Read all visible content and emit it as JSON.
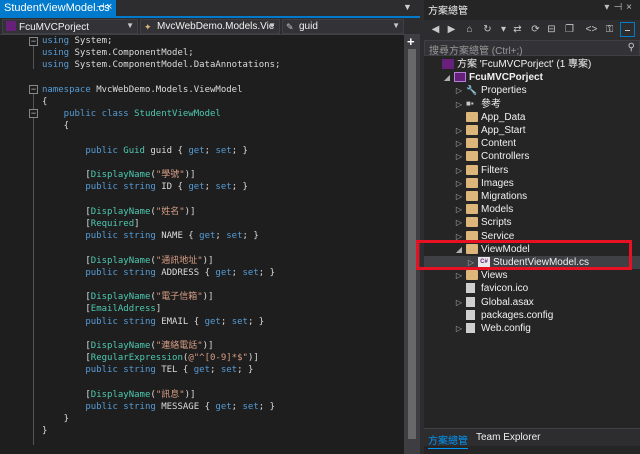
{
  "editor": {
    "tab_title": "StudentViewModel.cs",
    "tab_pin": "⊣",
    "tab_close": "×",
    "nav_project": "FcuMVCPorject",
    "nav_class": "MvcWebDemo.Models.Vie",
    "nav_member": "guid",
    "code_lines": [
      [
        {
          "t": "using",
          "c": "kw"
        },
        {
          "t": " System;",
          "c": "pl"
        }
      ],
      [
        {
          "t": "using",
          "c": "kw"
        },
        {
          "t": " System.ComponentModel;",
          "c": "pl"
        }
      ],
      [
        {
          "t": "using",
          "c": "kw"
        },
        {
          "t": " System.ComponentModel.DataAnnotations;",
          "c": "pl"
        }
      ],
      [],
      [
        {
          "t": "namespace",
          "c": "kw"
        },
        {
          "t": " MvcWebDemo.Models.ViewModel",
          "c": "pl"
        }
      ],
      [
        {
          "t": "{",
          "c": "pl"
        }
      ],
      [
        {
          "t": "    public class ",
          "c": "kw"
        },
        {
          "t": "StudentViewModel",
          "c": "ty"
        }
      ],
      [
        {
          "t": "    {",
          "c": "pl"
        }
      ],
      [],
      [
        {
          "t": "        public ",
          "c": "kw"
        },
        {
          "t": "Guid",
          "c": "ty"
        },
        {
          "t": " guid { ",
          "c": "pl"
        },
        {
          "t": "get",
          "c": "kw"
        },
        {
          "t": "; ",
          "c": "pl"
        },
        {
          "t": "set",
          "c": "kw"
        },
        {
          "t": "; }",
          "c": "pl"
        }
      ],
      [],
      [
        {
          "t": "        [",
          "c": "pl"
        },
        {
          "t": "DisplayName",
          "c": "ty"
        },
        {
          "t": "(",
          "c": "pl"
        },
        {
          "t": "\"學號\"",
          "c": "st"
        },
        {
          "t": ")]",
          "c": "pl"
        }
      ],
      [
        {
          "t": "        public string ",
          "c": "kw"
        },
        {
          "t": "ID { ",
          "c": "pl"
        },
        {
          "t": "get",
          "c": "kw"
        },
        {
          "t": "; ",
          "c": "pl"
        },
        {
          "t": "set",
          "c": "kw"
        },
        {
          "t": "; }",
          "c": "pl"
        }
      ],
      [],
      [
        {
          "t": "        [",
          "c": "pl"
        },
        {
          "t": "DisplayName",
          "c": "ty"
        },
        {
          "t": "(",
          "c": "pl"
        },
        {
          "t": "\"姓名\"",
          "c": "st"
        },
        {
          "t": ")]",
          "c": "pl"
        }
      ],
      [
        {
          "t": "        [",
          "c": "pl"
        },
        {
          "t": "Required",
          "c": "ty"
        },
        {
          "t": "]",
          "c": "pl"
        }
      ],
      [
        {
          "t": "        public string ",
          "c": "kw"
        },
        {
          "t": "NAME { ",
          "c": "pl"
        },
        {
          "t": "get",
          "c": "kw"
        },
        {
          "t": "; ",
          "c": "pl"
        },
        {
          "t": "set",
          "c": "kw"
        },
        {
          "t": "; }",
          "c": "pl"
        }
      ],
      [],
      [
        {
          "t": "        [",
          "c": "pl"
        },
        {
          "t": "DisplayName",
          "c": "ty"
        },
        {
          "t": "(",
          "c": "pl"
        },
        {
          "t": "\"通訊地址\"",
          "c": "st"
        },
        {
          "t": ")]",
          "c": "pl"
        }
      ],
      [
        {
          "t": "        public string ",
          "c": "kw"
        },
        {
          "t": "ADDRESS { ",
          "c": "pl"
        },
        {
          "t": "get",
          "c": "kw"
        },
        {
          "t": "; ",
          "c": "pl"
        },
        {
          "t": "set",
          "c": "kw"
        },
        {
          "t": "; }",
          "c": "pl"
        }
      ],
      [],
      [
        {
          "t": "        [",
          "c": "pl"
        },
        {
          "t": "DisplayName",
          "c": "ty"
        },
        {
          "t": "(",
          "c": "pl"
        },
        {
          "t": "\"電子信箱\"",
          "c": "st"
        },
        {
          "t": ")]",
          "c": "pl"
        }
      ],
      [
        {
          "t": "        [",
          "c": "pl"
        },
        {
          "t": "EmailAddress",
          "c": "ty"
        },
        {
          "t": "]",
          "c": "pl"
        }
      ],
      [
        {
          "t": "        public string ",
          "c": "kw"
        },
        {
          "t": "EMAIL { ",
          "c": "pl"
        },
        {
          "t": "get",
          "c": "kw"
        },
        {
          "t": "; ",
          "c": "pl"
        },
        {
          "t": "set",
          "c": "kw"
        },
        {
          "t": "; }",
          "c": "pl"
        }
      ],
      [],
      [
        {
          "t": "        [",
          "c": "pl"
        },
        {
          "t": "DisplayName",
          "c": "ty"
        },
        {
          "t": "(",
          "c": "pl"
        },
        {
          "t": "\"連絡電話\"",
          "c": "st"
        },
        {
          "t": ")]",
          "c": "pl"
        }
      ],
      [
        {
          "t": "        [",
          "c": "pl"
        },
        {
          "t": "RegularExpression",
          "c": "ty"
        },
        {
          "t": "(",
          "c": "pl"
        },
        {
          "t": "@\"^[0-9]*$\"",
          "c": "st"
        },
        {
          "t": ")]",
          "c": "pl"
        }
      ],
      [
        {
          "t": "        public string ",
          "c": "kw"
        },
        {
          "t": "TEL { ",
          "c": "pl"
        },
        {
          "t": "get",
          "c": "kw"
        },
        {
          "t": "; ",
          "c": "pl"
        },
        {
          "t": "set",
          "c": "kw"
        },
        {
          "t": "; }",
          "c": "pl"
        }
      ],
      [],
      [
        {
          "t": "        [",
          "c": "pl"
        },
        {
          "t": "DisplayName",
          "c": "ty"
        },
        {
          "t": "(",
          "c": "pl"
        },
        {
          "t": "\"訊息\"",
          "c": "st"
        },
        {
          "t": ")]",
          "c": "pl"
        }
      ],
      [
        {
          "t": "        public string ",
          "c": "kw"
        },
        {
          "t": "MESSAGE { ",
          "c": "pl"
        },
        {
          "t": "get",
          "c": "kw"
        },
        {
          "t": "; ",
          "c": "pl"
        },
        {
          "t": "set",
          "c": "kw"
        },
        {
          "t": "; }",
          "c": "pl"
        }
      ],
      [
        {
          "t": "    }",
          "c": "pl"
        }
      ],
      [
        {
          "t": "}",
          "c": "pl"
        }
      ]
    ]
  },
  "solution_explorer": {
    "title": "方案總管",
    "search_placeholder": "搜尋方案總管 (Ctrl+;)",
    "tree": [
      {
        "label": "方案 'FcuMVCPorject' (1 專案)",
        "depth": 0,
        "expander": "",
        "icon": "solution-icon"
      },
      {
        "label": "FcuMVCPorject",
        "depth": 1,
        "expander": "◢",
        "icon": "project-icon",
        "bold": true
      },
      {
        "label": "Properties",
        "depth": 2,
        "expander": "▷",
        "icon": "wrench-icon"
      },
      {
        "label": "參考",
        "depth": 2,
        "expander": "▷",
        "icon": "references-icon"
      },
      {
        "label": "App_Data",
        "depth": 2,
        "expander": "",
        "icon": "folder-icon"
      },
      {
        "label": "App_Start",
        "depth": 2,
        "expander": "▷",
        "icon": "folder-icon"
      },
      {
        "label": "Content",
        "depth": 2,
        "expander": "▷",
        "icon": "folder-icon"
      },
      {
        "label": "Controllers",
        "depth": 2,
        "expander": "▷",
        "icon": "folder-icon"
      },
      {
        "label": "Filters",
        "depth": 2,
        "expander": "▷",
        "icon": "folder-icon"
      },
      {
        "label": "Images",
        "depth": 2,
        "expander": "▷",
        "icon": "folder-icon"
      },
      {
        "label": "Migrations",
        "depth": 2,
        "expander": "▷",
        "icon": "folder-icon"
      },
      {
        "label": "Models",
        "depth": 2,
        "expander": "▷",
        "icon": "folder-icon"
      },
      {
        "label": "Scripts",
        "depth": 2,
        "expander": "▷",
        "icon": "folder-icon"
      },
      {
        "label": "Service",
        "depth": 2,
        "expander": "▷",
        "icon": "folder-icon"
      },
      {
        "label": "ViewModel",
        "depth": 2,
        "expander": "◢",
        "icon": "folder-icon"
      },
      {
        "label": "StudentViewModel.cs",
        "depth": 3,
        "expander": "▷",
        "icon": "csharp-file-icon",
        "selected": true
      },
      {
        "label": "Views",
        "depth": 2,
        "expander": "▷",
        "icon": "folder-icon"
      },
      {
        "label": "favicon.ico",
        "depth": 2,
        "expander": "",
        "icon": "file-icon"
      },
      {
        "label": "Global.asax",
        "depth": 2,
        "expander": "▷",
        "icon": "file-icon"
      },
      {
        "label": "packages.config",
        "depth": 2,
        "expander": "",
        "icon": "file-icon"
      },
      {
        "label": "Web.config",
        "depth": 2,
        "expander": "▷",
        "icon": "file-icon"
      }
    ],
    "bottom_tabs": [
      "方案總管",
      "Team Explorer"
    ]
  },
  "colors": {
    "accent": "#007acc",
    "highlight": "#e81123",
    "keyword": "#569cd6",
    "type": "#4ec9b0",
    "string": "#d69d85"
  }
}
